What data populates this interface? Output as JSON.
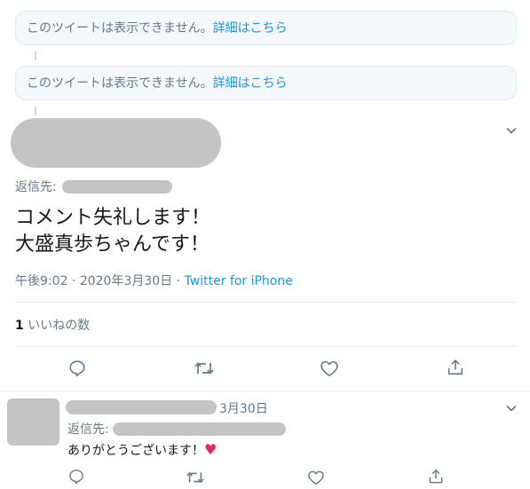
{
  "unavailable": [
    {
      "text": "このツイートは表示できません。",
      "link": "詳細はこちら"
    },
    {
      "text": "このツイートは表示できません。",
      "link": "詳細はこちら"
    }
  ],
  "main_tweet": {
    "reply_to_label": "返信先:",
    "text_line1": "コメント失礼します！",
    "text_line2": "大盛真歩ちゃんです！",
    "time": "午後9:02",
    "sep1": "·",
    "date": "2020年3月30日",
    "sep2": "·",
    "source": "Twitter for iPhone",
    "like_count": "1",
    "like_label": "いいねの数"
  },
  "reply_tweet": {
    "date": "3月30日",
    "reply_to_label": "返信先:",
    "text": "ありがとうございます！"
  },
  "colors": {
    "accent": "#1b95e0",
    "like_red": "#e0245e",
    "muted": "#657786"
  },
  "icons": [
    "chevron-down-icon",
    "reply-icon",
    "retweet-icon",
    "like-icon",
    "share-icon",
    "heart-emoji-icon"
  ]
}
